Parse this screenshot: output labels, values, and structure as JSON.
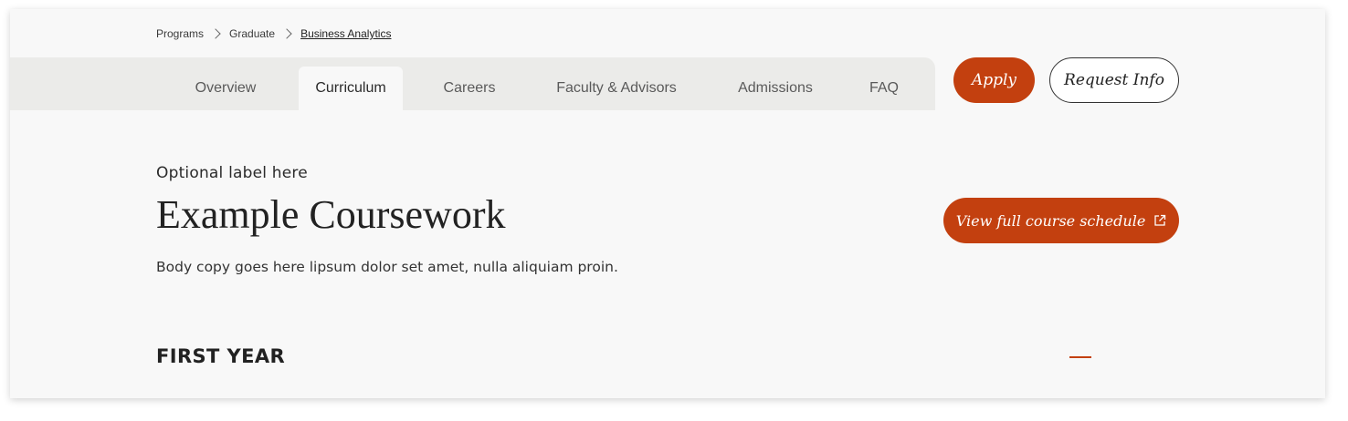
{
  "breadcrumb": {
    "items": [
      "Programs",
      "Graduate",
      "Business Analytics"
    ]
  },
  "tabs": [
    {
      "label": "Overview",
      "active": false
    },
    {
      "label": "Curriculum",
      "active": true
    },
    {
      "label": "Careers",
      "active": false
    },
    {
      "label": "Faculty & Advisors",
      "active": false
    },
    {
      "label": "Admissions",
      "active": false
    },
    {
      "label": "FAQ",
      "active": false
    }
  ],
  "header_buttons": {
    "apply": "Apply",
    "request_info": "Request Info"
  },
  "content": {
    "label": "Optional label here",
    "title": "Example Coursework",
    "body": "Body copy goes here lipsum dolor set amet, nulla aliquiam proin.",
    "schedule_button": "View full course schedule"
  },
  "section": {
    "title": "FIRST YEAR"
  },
  "colors": {
    "accent": "#c3400f",
    "tabbar": "#ebebe9",
    "background": "#f8f8f8"
  },
  "icons": {
    "schedule_button": "external-link-icon",
    "section_toggle": "minus-icon"
  }
}
